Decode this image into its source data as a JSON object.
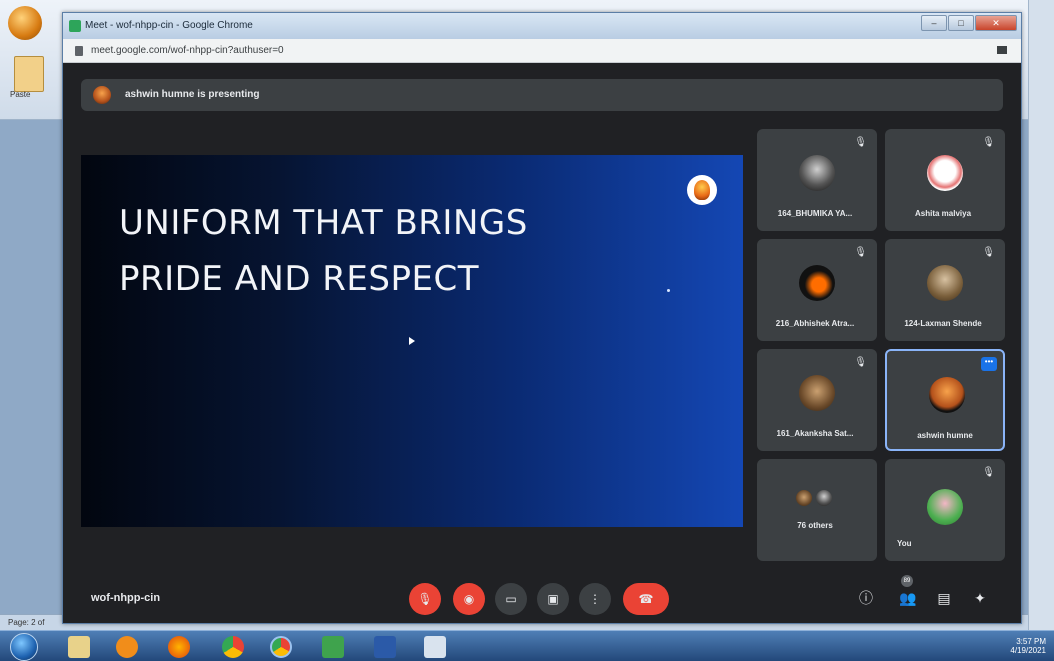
{
  "background_app": {
    "paste_label": "Paste",
    "status_text": "Page: 2 of"
  },
  "browser": {
    "window_title": "Meet - wof-nhpp-cin - Google Chrome",
    "url": "meet.google.com/wof-nhpp-cin?authuser=0",
    "window_buttons": [
      "–",
      "□",
      "✕"
    ]
  },
  "meet": {
    "presenting_text": "ashwin humne is presenting",
    "slide": {
      "title_line1": "UNIFORM THAT BRINGS",
      "title_line2": "PRIDE AND RESPECT"
    },
    "participants": [
      {
        "name": "164_BHUMIKA YA...",
        "icon": "mic-off-icon"
      },
      {
        "name": "Ashita malviya",
        "icon": "mic-off-icon"
      },
      {
        "name": "216_Abhishek Atra...",
        "icon": "mic-off-icon"
      },
      {
        "name": "124-Laxman Shende",
        "icon": "mic-off-icon"
      },
      {
        "name": "161_Akanksha Sat...",
        "icon": "mic-off-icon"
      },
      {
        "name": "ashwin humne",
        "icon": "more-options-icon"
      },
      {
        "name": "76 others",
        "icon": ""
      },
      {
        "name": "You",
        "icon": "mic-off-icon"
      }
    ],
    "meeting_code": "wof-nhpp-cin",
    "participant_badge": "89"
  },
  "taskbar": {
    "time": "3:57 PM",
    "date": "4/19/2021"
  }
}
